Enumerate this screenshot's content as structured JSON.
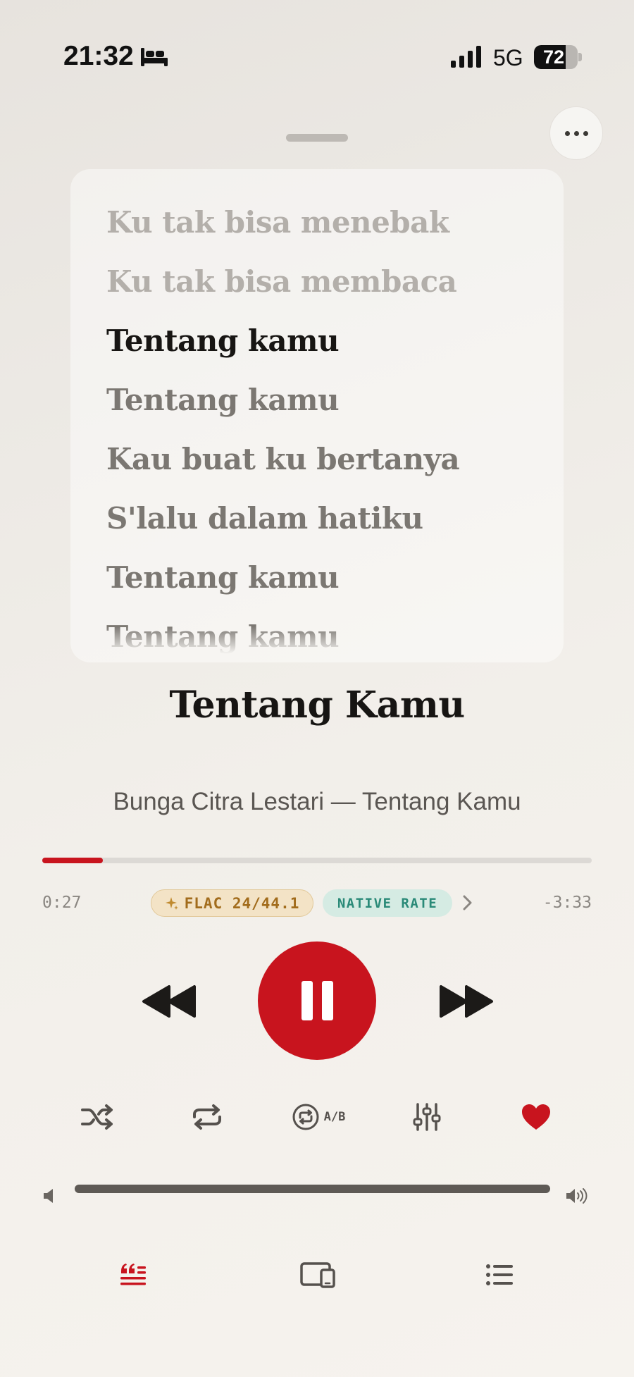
{
  "status_bar": {
    "time": "21:32",
    "network": "5G",
    "battery_level": "72",
    "battery_fraction": 0.72,
    "icons": [
      "bed-icon",
      "signal-icon",
      "battery-icon"
    ]
  },
  "header": {
    "more_icon": "ellipsis-icon"
  },
  "lyrics": {
    "lines": [
      "Ku tak bisa menebak",
      "Ku tak bisa membaca",
      "Tentang kamu",
      "Tentang kamu",
      "Kau buat ku bertanya",
      "S'lalu dalam hatiku",
      "Tentang kamu",
      "Tentang kamu"
    ],
    "current_index": 2
  },
  "track": {
    "title": "Tentang Kamu",
    "subtitle": "Bunga Citra Lestari — Tentang Kamu"
  },
  "playback": {
    "elapsed": "0:27",
    "remaining": "-3:33",
    "progress_fraction": 0.11,
    "format_badge": "FLAC 24/44.1",
    "rate_badge": "NATIVE RATE",
    "state": "playing"
  },
  "controls": {
    "ab_label": "A/B",
    "favorited": true
  },
  "volume": {
    "level": 1.0
  },
  "colors": {
    "accent": "#c8141e",
    "badge_flac_bg": "#f3e3c6",
    "badge_flac_text": "#a26c1c",
    "badge_native_bg": "#d5ebe3",
    "badge_native_text": "#2a8a78"
  },
  "tabs": [
    "lyrics",
    "devices",
    "queue"
  ],
  "active_tab": "lyrics"
}
